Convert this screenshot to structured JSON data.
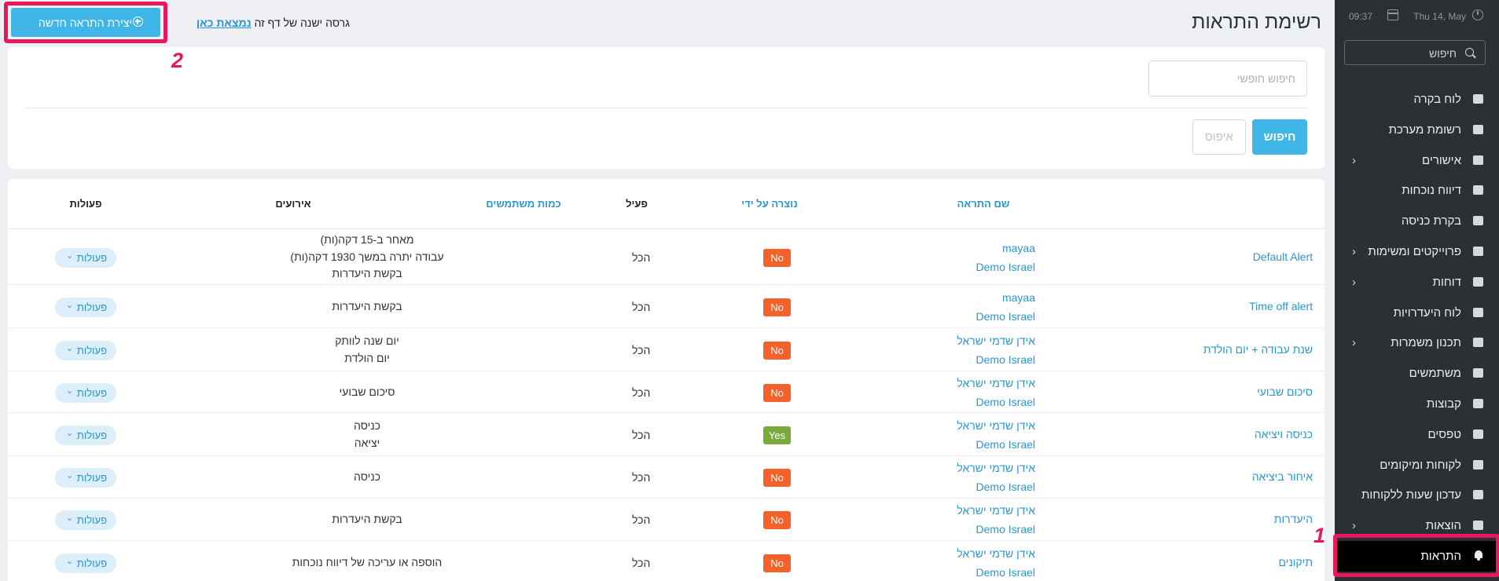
{
  "sidebar": {
    "time": "09:37",
    "date": "Thu 14, May",
    "search_placeholder": "חיפוש",
    "items": [
      {
        "label": "לוח בקרה",
        "icon": "dashboard-icon",
        "arrow": ""
      },
      {
        "label": "רשומת מערכת",
        "icon": "inbox-icon",
        "arrow": ""
      },
      {
        "label": "אישורים",
        "icon": "check-square-icon",
        "arrow": "›"
      },
      {
        "label": "דיווח נוכחות",
        "icon": "calendar-icon",
        "arrow": ""
      },
      {
        "label": "בקרת כניסה",
        "icon": "sign-in-icon",
        "arrow": ""
      },
      {
        "label": "פרוייקטים ומשימות",
        "icon": "tasks-icon",
        "arrow": "›"
      },
      {
        "label": "דוחות",
        "icon": "list-icon",
        "arrow": "›"
      },
      {
        "label": "לוח היעדרויות",
        "icon": "calendar-grid-icon",
        "arrow": ""
      },
      {
        "label": "תכנון משמרות",
        "icon": "refresh-icon",
        "arrow": "›"
      },
      {
        "label": "משתמשים",
        "icon": "user-icon",
        "arrow": ""
      },
      {
        "label": "קבוצות",
        "icon": "users-icon",
        "arrow": ""
      },
      {
        "label": "טפסים",
        "icon": "file-icon",
        "arrow": ""
      },
      {
        "label": "לקוחות ומיקומים",
        "icon": "cart-icon",
        "arrow": ""
      },
      {
        "label": "עדכון שעות ללקוחות",
        "icon": "clock-icon",
        "arrow": ""
      },
      {
        "label": "הוצאות",
        "icon": "money-icon",
        "arrow": "›"
      },
      {
        "label": "התראות",
        "icon": "bell-icon",
        "arrow": ""
      }
    ]
  },
  "annotations": {
    "one": "1",
    "two": "2"
  },
  "header": {
    "title": "רשימת התראות",
    "create_button": "יצירת התראה חדשה",
    "old_version_text": "גרסה ישנה של דף זה",
    "old_version_link": "נמצאת כאן"
  },
  "search": {
    "placeholder": "חיפוש חופשי",
    "search_button": "חיפוש",
    "reset_button": "איפוס"
  },
  "table": {
    "columns": {
      "name": "שם התראה",
      "created_by": "נוצרה על ידי",
      "active": "פעיל",
      "user_count": "כמות משתמשים",
      "events": "אירועים",
      "actions": "פעולות"
    },
    "rows": [
      {
        "name": "Default Alert",
        "created_by": [
          "mayaa",
          "Demo Israel"
        ],
        "active": "No",
        "users": "הכל",
        "events": [
          "מאחר ב-15 דקה(ות)",
          "עבודה יתרה במשך 1930 דקה(ות)",
          "בקשת היעדרות"
        ],
        "action": "פעולות"
      },
      {
        "name": "Time off alert",
        "created_by": [
          "mayaa",
          "Demo Israel"
        ],
        "active": "No",
        "users": "הכל",
        "events": [
          "בקשת היעדרות"
        ],
        "action": "פעולות"
      },
      {
        "name": "שנת עבודה + יום הולדת",
        "created_by": [
          "אידן שדמי ישראל",
          "Demo Israel"
        ],
        "active": "No",
        "users": "הכל",
        "events": [
          "יום שנה לוותק",
          "יום הולדת"
        ],
        "action": "פעולות"
      },
      {
        "name": "סיכום שבועי",
        "created_by": [
          "אידן שדמי ישראל",
          "Demo Israel"
        ],
        "active": "No",
        "users": "הכל",
        "events": [
          "סיכום שבועי"
        ],
        "action": "פעולות"
      },
      {
        "name": "כניסה ויציאה",
        "created_by": [
          "אידן שדמי ישראל",
          "Demo Israel"
        ],
        "active": "Yes",
        "users": "הכל",
        "events": [
          "כניסה",
          "יציאה"
        ],
        "action": "פעולות"
      },
      {
        "name": "איחור ביציאה",
        "created_by": [
          "אידן שדמי ישראל",
          "Demo Israel"
        ],
        "active": "No",
        "users": "הכל",
        "events": [
          "כניסה"
        ],
        "action": "פעולות"
      },
      {
        "name": "היעדרות",
        "created_by": [
          "אידן שדמי ישראל",
          "Demo Israel"
        ],
        "active": "No",
        "users": "הכל",
        "events": [
          "בקשת היעדרות"
        ],
        "action": "פעולות"
      },
      {
        "name": "תיקונים",
        "created_by": [
          "אידן שדמי ישראל",
          "Demo Israel"
        ],
        "active": "No",
        "users": "הכל",
        "events": [
          "הוספה או עריכה של דיווח נוכחות"
        ],
        "action": "פעולות"
      }
    ]
  }
}
